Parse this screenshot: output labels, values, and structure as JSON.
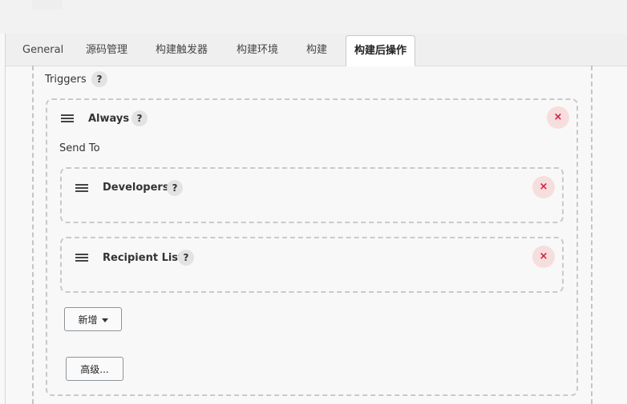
{
  "tabs": [
    {
      "label": "General"
    },
    {
      "label": "源码管理"
    },
    {
      "label": "构建触发器"
    },
    {
      "label": "构建环境"
    },
    {
      "label": "构建"
    },
    {
      "label": "构建后操作",
      "active": true
    }
  ],
  "triggers": {
    "label": "Triggers",
    "help": "?",
    "trigger": {
      "name": "Always",
      "help": "?",
      "delete": "×",
      "send_to": "Send To",
      "recipients": [
        {
          "name": "Developers",
          "help": "?",
          "delete": "×"
        },
        {
          "name": "Recipient List",
          "help": "?",
          "delete": "×"
        }
      ],
      "add_button": "新增",
      "advanced_button": "高级..."
    }
  }
}
